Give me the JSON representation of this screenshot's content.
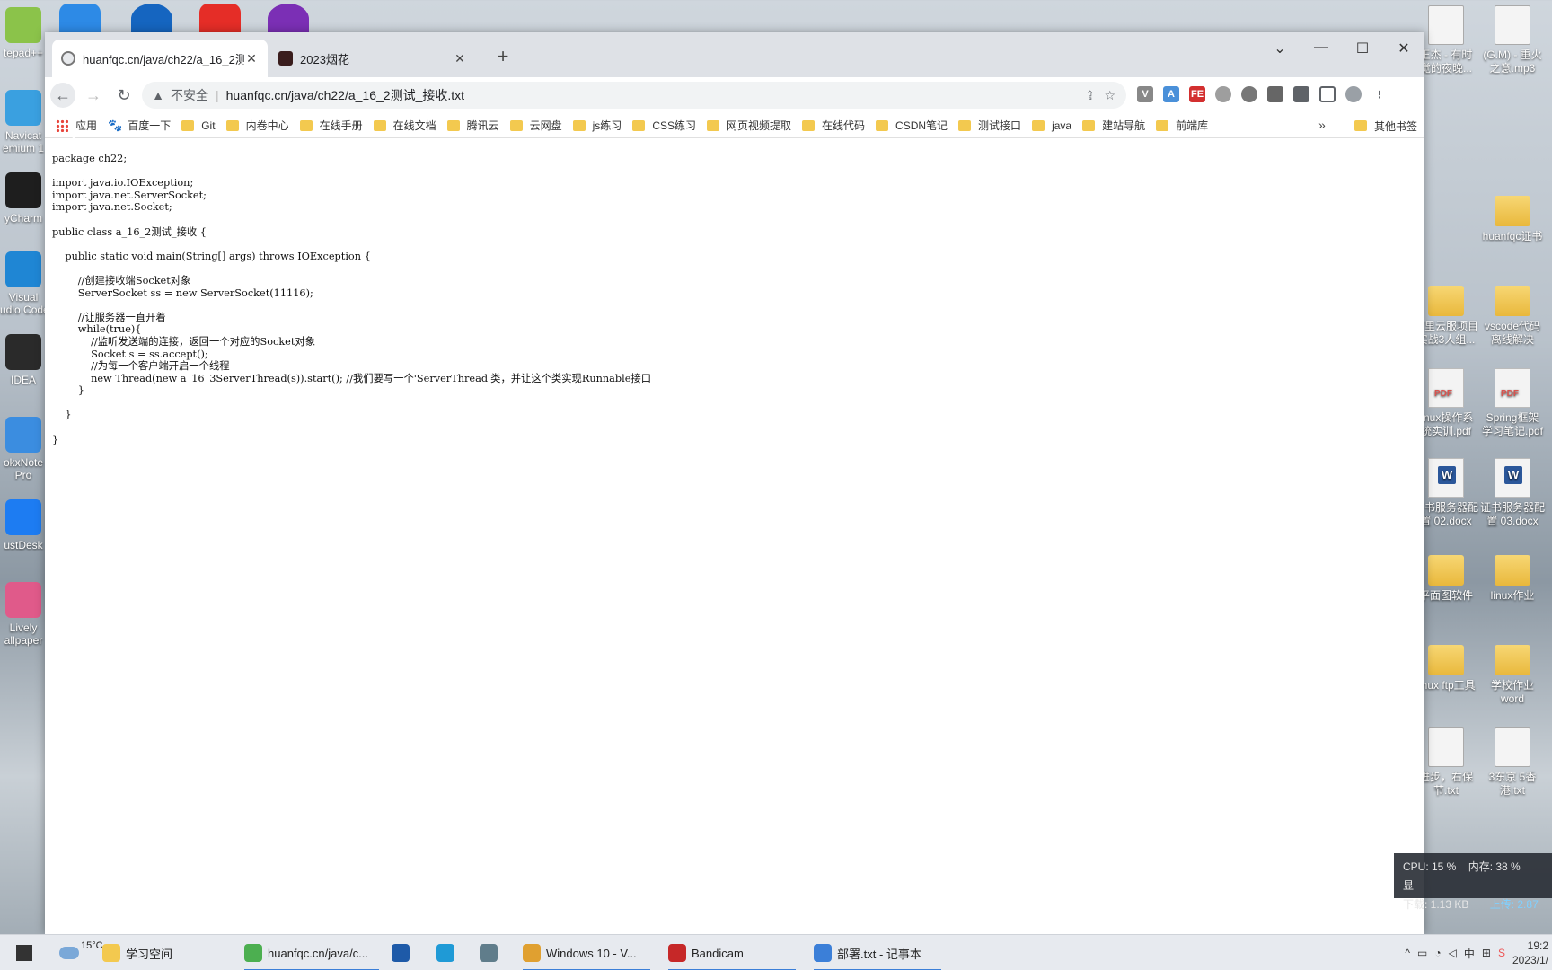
{
  "browser": {
    "tabs": [
      {
        "title": "huanfqc.cn/java/ch22/a_16_2测",
        "active": true
      },
      {
        "title": "2023烟花",
        "active": false
      }
    ],
    "address": {
      "security_label": "不安全",
      "url": "huanfqc.cn/java/ch22/a_16_2测试_接收.txt"
    },
    "bookmarks": [
      {
        "label": "应用",
        "type": "apps"
      },
      {
        "label": "百度一下",
        "type": "baidu"
      },
      {
        "label": "Git",
        "type": "folder"
      },
      {
        "label": "内卷中心",
        "type": "folder"
      },
      {
        "label": "在线手册",
        "type": "folder"
      },
      {
        "label": "在线文档",
        "type": "folder"
      },
      {
        "label": "腾讯云",
        "type": "folder"
      },
      {
        "label": "云网盘",
        "type": "folder"
      },
      {
        "label": "js练习",
        "type": "folder"
      },
      {
        "label": "CSS练习",
        "type": "folder"
      },
      {
        "label": "网页视频提取",
        "type": "folder"
      },
      {
        "label": "在线代码",
        "type": "folder"
      },
      {
        "label": "CSDN笔记",
        "type": "folder"
      },
      {
        "label": "测试接口",
        "type": "folder"
      },
      {
        "label": "java",
        "type": "folder"
      },
      {
        "label": "建站导航",
        "type": "folder"
      },
      {
        "label": "前端库",
        "type": "folder"
      }
    ],
    "bookmarks_more": "»",
    "bookmarks_other": "其他书签"
  },
  "document": {
    "code": "package ch22;\n\nimport java.io.IOException;\nimport java.net.ServerSocket;\nimport java.net.Socket;\n\npublic class a_16_2测试_接收 {\n\n    public static void main(String[] args) throws IOException {\n\n        //创建接收端Socket对象\n        ServerSocket ss = new ServerSocket(11116);\n\n        //让服务器一直开着\n        while(true){\n            //监听发送端的连接，返回一个对应的Socket对象\n            Socket s = ss.accept();\n            //为每一个客户端开启一个线程\n            new Thread(new a_16_3ServerThread(s)).start(); //我们要写一个'ServerThread'类，并让这个类实现Runnable接口\n        }\n\n    }\n\n}"
  },
  "desktop": {
    "left_icons": [
      {
        "label": "tepad++",
        "color": "#8bc34a"
      },
      {
        "label": "Navicat\nemium 1",
        "color": "#3aa0e0"
      },
      {
        "label": "yCharm",
        "color": "#1e1e1e"
      },
      {
        "label": "Visual\nudio Code",
        "color": "#1f86d4"
      },
      {
        "label": "IDEA",
        "color": "#2a2a2a"
      },
      {
        "label": "okxNote\nPro",
        "color": "#3b8de0"
      },
      {
        "label": "ustDesk",
        "color": "#1d7cf2"
      },
      {
        "label": "Lively\nallpaper",
        "color": "#e05a8a"
      }
    ],
    "right_icons": [
      {
        "label": "王杰 - 有时\n觉的夜晚...",
        "type": "file"
      },
      {
        "label": "(G.M) - 重火\n之意.mp3",
        "type": "file"
      },
      {
        "label": "huanfqc证书",
        "type": "folder"
      },
      {
        "label": "阿里云服项目\n实战3人组...",
        "type": "folder"
      },
      {
        "label": "vscode代码\n离线解决",
        "type": "folder"
      },
      {
        "label": "linux操作系\n统实训.pdf",
        "type": "pdf"
      },
      {
        "label": "Spring框架\n学习笔记.pdf",
        "type": "pdf"
      },
      {
        "label": "证书服务器配\n置 02.docx",
        "type": "word"
      },
      {
        "label": "证书服务器配\n置 03.docx",
        "type": "word"
      },
      {
        "label": "平面图软件",
        "type": "folder"
      },
      {
        "label": "linux作业",
        "type": "folder"
      },
      {
        "label": "linux ftp工具",
        "type": "folder"
      },
      {
        "label": "学校作业\nword",
        "type": "folder"
      },
      {
        "label": "进步，右保\n节.txt",
        "type": "file"
      },
      {
        "label": "3东京 5香\n港.txt",
        "type": "file"
      }
    ]
  },
  "perf": {
    "cpu": "CPU: 15 %",
    "mem": "内存: 38 %",
    "extra": "显",
    "down": "下载: 1.13 KB",
    "up": "上传: 2.87"
  },
  "taskbar": {
    "weather": "15°C",
    "items": [
      {
        "label": "学习空间",
        "color": "#f3c94f"
      },
      {
        "label": "huanfqc.cn/java/c...",
        "color": "#4caf50",
        "active": true
      },
      {
        "label": "",
        "color": "#1e5aa8"
      },
      {
        "label": "",
        "color": "#1f9ad6"
      },
      {
        "label": "",
        "color": "#607d8b"
      },
      {
        "label": "Windows 10 - V...",
        "color": "#e0a030",
        "active": true
      },
      {
        "label": "Bandicam",
        "color": "#c62828",
        "active": true
      },
      {
        "label": "部署.txt - 记事本",
        "color": "#3b7fd8",
        "active": true
      }
    ],
    "time": "19:2",
    "date": "2023/1/"
  }
}
